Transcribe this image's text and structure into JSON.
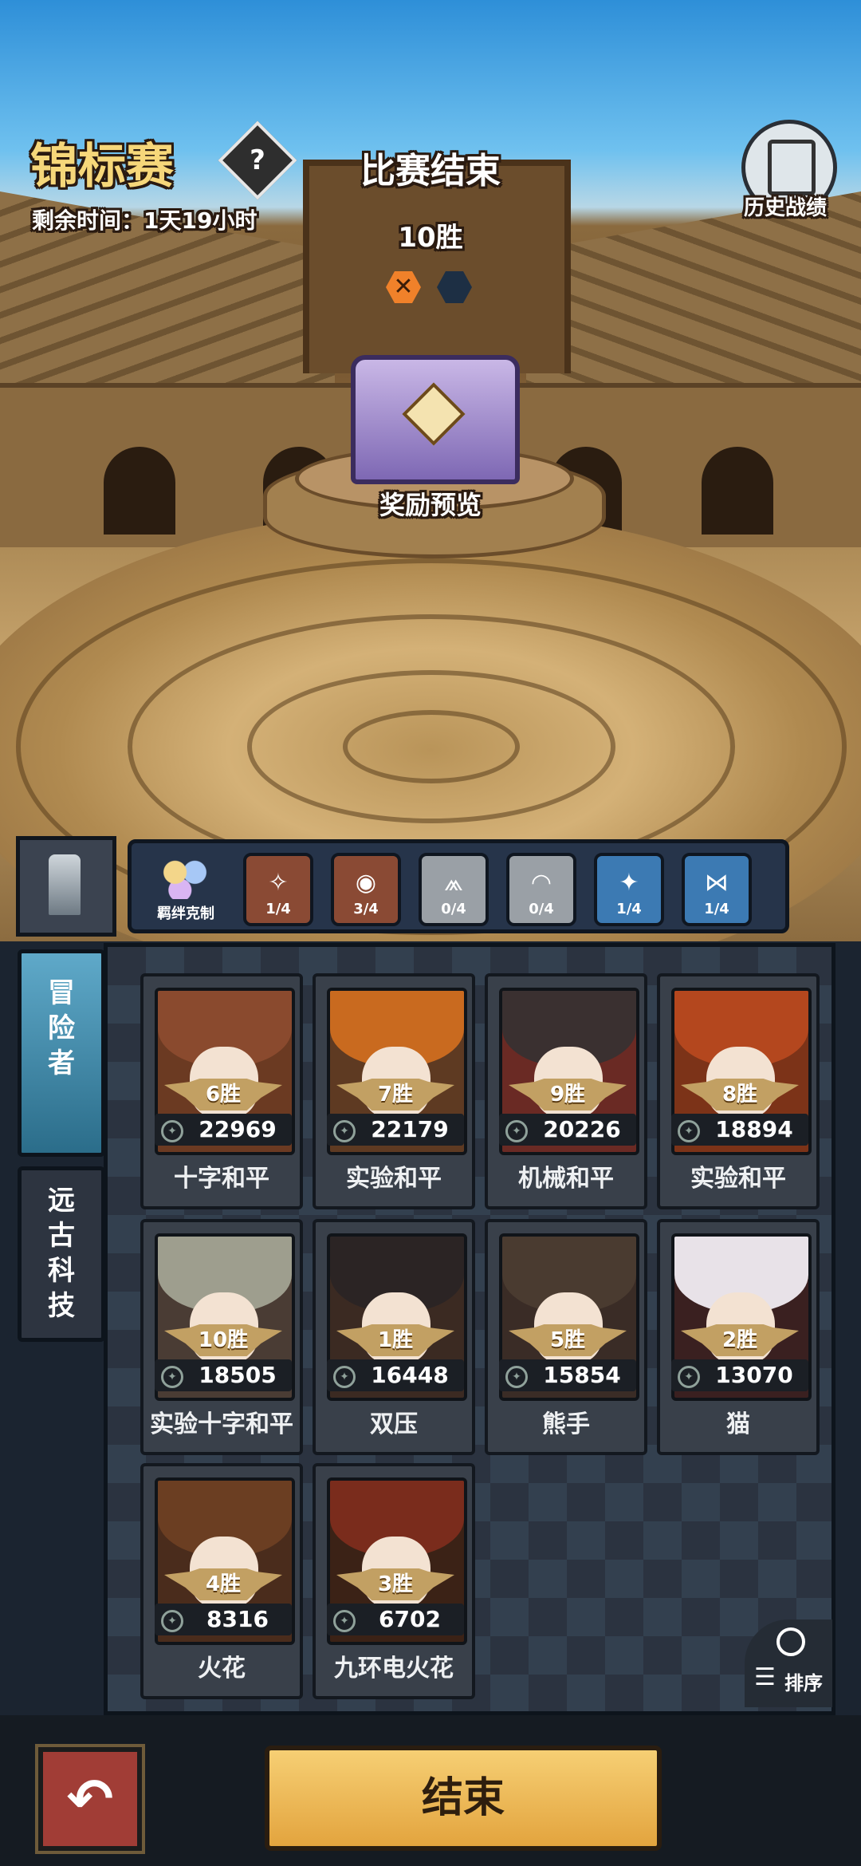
{
  "header": {
    "title": "锦标赛",
    "help": "?",
    "remaining": "剩余时间：1天19小时",
    "status": "比赛结束",
    "wins": "10胜",
    "history_label": "历史战绩",
    "reward_preview": "奖励预览"
  },
  "synergy": {
    "bond_label": "羁绊克制",
    "items": [
      {
        "count": "1/4",
        "icon": "✧",
        "color": "brown"
      },
      {
        "count": "3/4",
        "icon": "◉",
        "color": "brown"
      },
      {
        "count": "0/4",
        "icon": "⩕",
        "color": "grey"
      },
      {
        "count": "0/4",
        "icon": "◠",
        "color": "grey"
      },
      {
        "count": "1/4",
        "icon": "✦",
        "color": "blue"
      },
      {
        "count": "1/4",
        "icon": "⋈",
        "color": "blue"
      }
    ]
  },
  "tabs": {
    "adventurer": "冒险者",
    "ancient_tech": "远古科技"
  },
  "cards": [
    {
      "wins": "6胜",
      "power": "22969",
      "name": "十字和平"
    },
    {
      "wins": "7胜",
      "power": "22179",
      "name": "实验和平"
    },
    {
      "wins": "9胜",
      "power": "20226",
      "name": "机械和平"
    },
    {
      "wins": "8胜",
      "power": "18894",
      "name": "实验和平"
    },
    {
      "wins": "10胜",
      "power": "18505",
      "name": "实验十字和平"
    },
    {
      "wins": "1胜",
      "power": "16448",
      "name": "双压"
    },
    {
      "wins": "5胜",
      "power": "15854",
      "name": "熊手"
    },
    {
      "wins": "2胜",
      "power": "13070",
      "name": "猫"
    },
    {
      "wins": "4胜",
      "power": "8316",
      "name": "火花"
    },
    {
      "wins": "3胜",
      "power": "6702",
      "name": "九环电火花"
    }
  ],
  "sort_label": "排序",
  "end_button": "结束",
  "back_icon": "↶"
}
